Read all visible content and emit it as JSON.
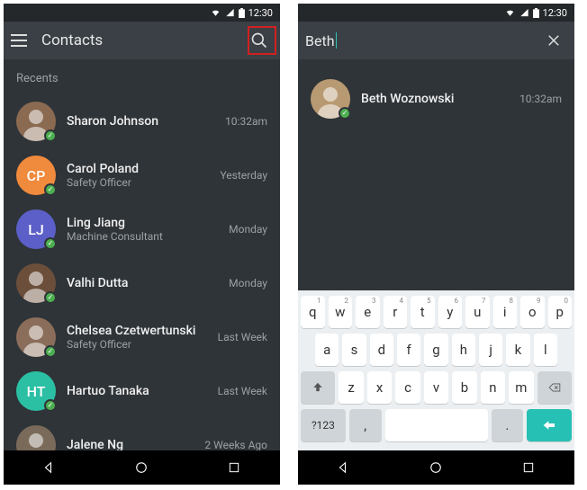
{
  "status": {
    "time": "12:30"
  },
  "left": {
    "title": "Contacts",
    "section": "Recents",
    "contacts": [
      {
        "name": "Sharon Johnson",
        "sub": "",
        "time": "10:32am",
        "avatar": {
          "type": "photo",
          "bg": "#8b6a52"
        },
        "presence": true
      },
      {
        "name": "Carol Poland",
        "sub": "Safety Officer",
        "time": "Yesterday",
        "avatar": {
          "type": "initials",
          "text": "CP",
          "bg": "#f08a3c"
        },
        "presence": true
      },
      {
        "name": "Ling Jiang",
        "sub": "Machine Consultant",
        "time": "Monday",
        "avatar": {
          "type": "initials",
          "text": "LJ",
          "bg": "#5b5fc7"
        },
        "presence": true
      },
      {
        "name": "Valhi Dutta",
        "sub": "",
        "time": "Monday",
        "avatar": {
          "type": "photo",
          "bg": "#6b4f3b"
        },
        "presence": true
      },
      {
        "name": "Chelsea Czetwertunski",
        "sub": "Safety Officer",
        "time": "Last Week",
        "avatar": {
          "type": "photo",
          "bg": "#8a6d5a"
        },
        "presence": true
      },
      {
        "name": "Hartuo Tanaka",
        "sub": "",
        "time": "Last Week",
        "avatar": {
          "type": "initials",
          "text": "HT",
          "bg": "#2bbfa3"
        },
        "presence": true
      },
      {
        "name": "Jalene Ng",
        "sub": "",
        "time": "2 Weeks Ago",
        "avatar": {
          "type": "photo",
          "bg": "#7a6a5a"
        },
        "presence": false
      }
    ]
  },
  "right": {
    "query": "Beth",
    "results": [
      {
        "name": "Beth Woznowski",
        "sub": "",
        "time": "10:32am",
        "avatar": {
          "type": "photo",
          "bg": "#b89a72"
        },
        "presence": true
      }
    ]
  },
  "keyboard": {
    "row1": [
      "q",
      "w",
      "e",
      "r",
      "t",
      "y",
      "u",
      "i",
      "o",
      "p"
    ],
    "hints": [
      "1",
      "2",
      "3",
      "4",
      "5",
      "6",
      "7",
      "8",
      "9",
      "0"
    ],
    "row2": [
      "a",
      "s",
      "d",
      "f",
      "g",
      "h",
      "j",
      "k",
      "l"
    ],
    "row3": [
      "z",
      "x",
      "c",
      "v",
      "b",
      "n",
      "m"
    ],
    "symKey": "?123",
    "comma": ",",
    "period": "."
  }
}
